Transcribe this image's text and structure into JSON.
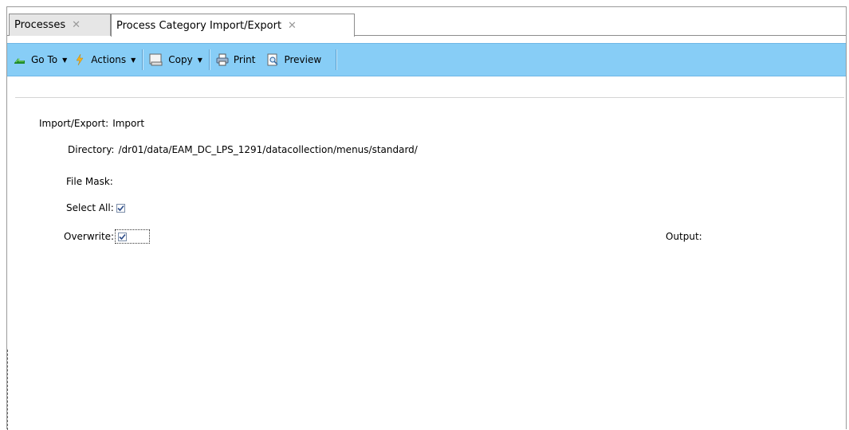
{
  "tabs": [
    {
      "label": "Processes",
      "close": "✕"
    },
    {
      "label": "Process Category Import/Export",
      "close": "✕"
    }
  ],
  "toolbar": {
    "goto_label": "Go To",
    "actions_label": "Actions",
    "copy_label": "Copy",
    "print_label": "Print",
    "preview_label": "Preview",
    "caret": "▼"
  },
  "form": {
    "import_export_label": "Import/Export:",
    "import_export_value": "Import",
    "directory_label": "Directory:",
    "directory_value": "/dr01/data/EAM_DC_LPS_1291/datacollection/menus/standard/",
    "file_mask_label": "File Mask:",
    "file_mask_value": "",
    "select_all_label": "Select All:",
    "select_all_checked": true,
    "overwrite_label": "Overwrite:",
    "overwrite_checked": true,
    "output_label": "Output:"
  },
  "icons": {
    "goto": "go-to-icon",
    "actions": "lightning-icon",
    "copy": "copy-icon",
    "print": "printer-icon",
    "preview": "preview-icon"
  }
}
